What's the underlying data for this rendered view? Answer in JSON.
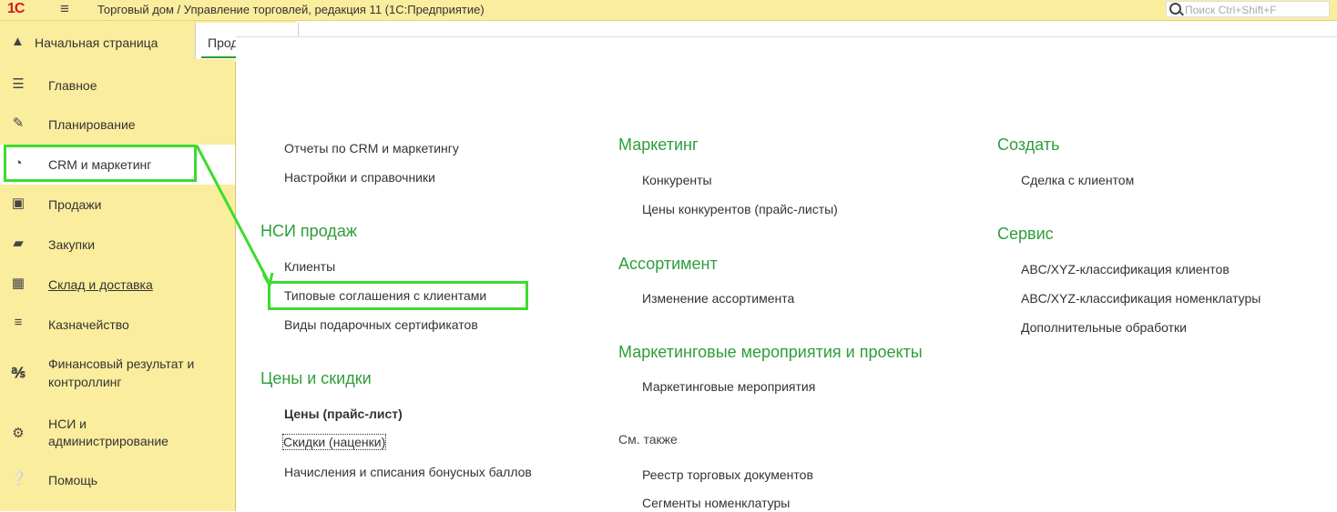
{
  "titlebar": {
    "logo": "1С",
    "title": "Торговый дом / Управление торговлей, редакция 11  (1С:Предприятие)",
    "search_placeholder": "Поиск Ctrl+Shift+F"
  },
  "tabs": {
    "home": "Начальная страница",
    "active": "Прод"
  },
  "sidebar": {
    "items": [
      {
        "label": "Главное",
        "icon": "menu-lines-icon"
      },
      {
        "label": "Планирование",
        "icon": "planning-icon"
      },
      {
        "label": "CRM и маркетинг",
        "icon": "pie-chart-icon"
      },
      {
        "label": "Продажи",
        "icon": "bag-icon"
      },
      {
        "label": "Закупки",
        "icon": "cart-icon"
      },
      {
        "label": "Склад и доставка",
        "icon": "warehouse-icon"
      },
      {
        "label": "Казначейство",
        "icon": "coins-icon"
      },
      {
        "label": "Финансовый результат и",
        "label2": "контроллинг",
        "icon": "bar-chart-icon"
      },
      {
        "label": "НСИ и",
        "label2": "администрирование",
        "icon": "gear-icon"
      },
      {
        "label": "Помощь",
        "icon": "help-icon"
      }
    ]
  },
  "col1": {
    "links_top": [
      "Отчеты по CRM и маркетингу",
      "Настройки и справочники"
    ],
    "nsi_heading": "НСИ продаж",
    "nsi_links": [
      "Клиенты",
      "Типовые соглашения с клиентами",
      "Виды подарочных сертификатов"
    ],
    "prices_heading": "Цены и скидки",
    "prices_links": [
      "Цены (прайс-лист)",
      "Скидки (наценки)",
      "Начисления и списания бонусных баллов"
    ]
  },
  "col2": {
    "marketing_heading": "Маркетинг",
    "marketing_links": [
      "Конкуренты",
      "Цены конкурентов (прайс-листы)"
    ],
    "assortment_heading": "Ассортимент",
    "assortment_links": [
      "Изменение ассортимента"
    ],
    "events_heading": "Маркетинговые мероприятия и проекты",
    "events_links": [
      "Маркетинговые мероприятия"
    ],
    "see_also": "См. также",
    "see_also_links": [
      "Реестр торговых документов",
      "Сегменты номенклатуры"
    ]
  },
  "col3": {
    "create_heading": "Создать",
    "create_links": [
      "Сделка с клиентом"
    ],
    "service_heading": "Сервис",
    "service_links": [
      "ABC/XYZ-классификация клиентов",
      "ABC/XYZ-классификация номенклатуры",
      "Дополнительные обработки"
    ]
  },
  "colors": {
    "accent_green": "#2e9e3a",
    "highlight_green": "#3ddc2f",
    "sidebar_bg": "#fbed9e",
    "logo_red": "#d71920"
  }
}
